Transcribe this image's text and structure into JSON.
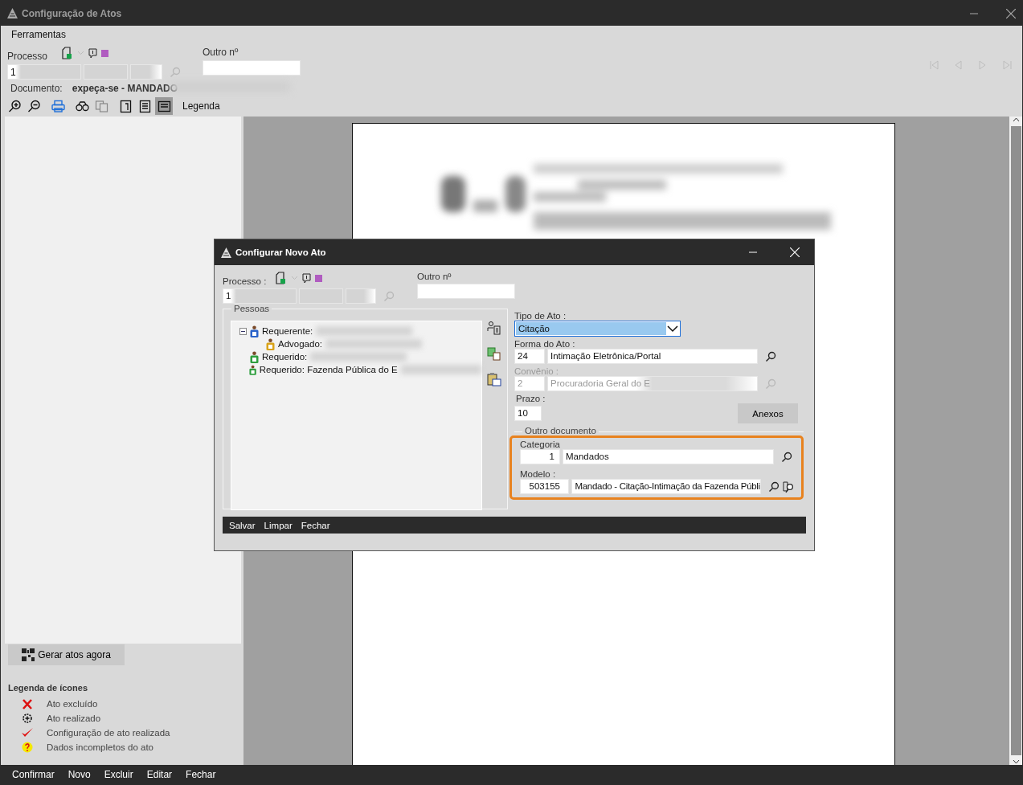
{
  "window": {
    "title": "Configuração de Atos"
  },
  "menu": [
    {
      "label": "Ferramentas"
    }
  ],
  "processo": {
    "label": "Processo",
    "value": "1",
    "other_label": "Outro nº"
  },
  "documento": {
    "label": "Documento:",
    "value": "expeça-se - MANDADO"
  },
  "toolbar": [
    {
      "kind": "zoom-in",
      "pressed": false,
      "disabled": false
    },
    {
      "kind": "zoom-out",
      "pressed": false,
      "disabled": false
    },
    {
      "kind": "print",
      "pressed": false,
      "disabled": false
    },
    {
      "kind": "find",
      "pressed": false,
      "disabled": false
    },
    {
      "kind": "copy",
      "pressed": false,
      "disabled": true
    },
    {
      "kind": "single-page",
      "pressed": false,
      "disabled": false
    },
    {
      "kind": "text-page",
      "pressed": false,
      "disabled": false
    },
    {
      "kind": "page-width",
      "pressed": true,
      "disabled": false
    },
    {
      "kind": "text",
      "label": "Legenda",
      "pressed": false,
      "disabled": false
    }
  ],
  "navigation": [
    {
      "kind": "first",
      "disabled": true
    },
    {
      "kind": "previous",
      "disabled": true
    },
    {
      "kind": "next",
      "disabled": true
    },
    {
      "kind": "last",
      "disabled": true
    }
  ],
  "generate_button": "Gerar atos agora",
  "legend": {
    "title": "Legenda de ícones",
    "items": [
      {
        "kind": "excluded",
        "label": "Ato excluído"
      },
      {
        "kind": "done",
        "label": "Ato realizado"
      },
      {
        "kind": "configured",
        "label": "Configuração de ato realizada"
      },
      {
        "kind": "incomplete",
        "label": "Dados incompletos do ato"
      }
    ]
  },
  "bottom_bar": [
    "Confirmar",
    "Novo",
    "Excluir",
    "Editar",
    "Fechar"
  ],
  "dialog": {
    "title": "Configurar Novo Ato",
    "processo": {
      "label": "Processo :",
      "value": "1",
      "other_label": "Outro nº"
    },
    "pessoas": {
      "title": "Pessoas",
      "tree": [
        {
          "label": "Requerente:",
          "color": "#2a62c9",
          "expanded": true,
          "children": [
            {
              "label": "Advogado:",
              "color": "#d9a31a"
            }
          ]
        },
        {
          "label": "Requerido:",
          "color": "#2e9e3e"
        },
        {
          "label": "Requerido: Fazenda Pública do E",
          "color": "#2e9e3e"
        }
      ]
    },
    "tipo_de_ato": {
      "label": "Tipo de Ato :",
      "value": "Citação"
    },
    "forma_do_ato": {
      "label": "Forma do Ato :",
      "code": "24",
      "name": "Intimação Eletrônica/Portal",
      "disabled": false
    },
    "convenio": {
      "label": "Convênio :",
      "code": "2",
      "name": "Procuradoria Geral do E",
      "disabled": true
    },
    "prazo": {
      "label": "Prazo :",
      "value": "10"
    },
    "anexos_button": "Anexos",
    "outro_documento": {
      "title": "Outro documento",
      "highlighted": true,
      "categoria": {
        "label": "Categoria",
        "code": "1",
        "name": "Mandados"
      },
      "modelo": {
        "label": "Modelo :",
        "code": "503155",
        "name": "Mandado - Citação-Intimação da Fazenda Públi"
      }
    },
    "actions": [
      "Salvar",
      "Limpar",
      "Fechar"
    ]
  }
}
